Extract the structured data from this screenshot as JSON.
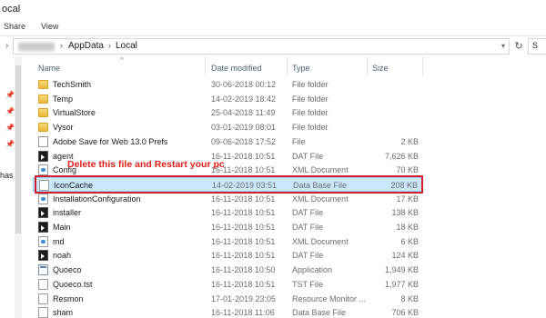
{
  "window": {
    "title_fragment": "ocal"
  },
  "ribbon": {
    "tabs": [
      "Share",
      "View"
    ]
  },
  "address": {
    "crumbs": [
      "AppData",
      "Local"
    ],
    "search_fragment": "S"
  },
  "navpane": {
    "fragments": [
      "",
      "has"
    ]
  },
  "columns": {
    "name": "Name",
    "date": "Date modified",
    "type": "Type",
    "size": "Size"
  },
  "files": [
    {
      "name": "TechSmith",
      "date": "30-06-2018 00:12",
      "type": "File folder",
      "size": "",
      "icon": "folder-icon"
    },
    {
      "name": "Temp",
      "date": "14-02-2019 18:42",
      "type": "File folder",
      "size": "",
      "icon": "folder-icon"
    },
    {
      "name": "VirtualStore",
      "date": "25-04-2018 11:49",
      "type": "File folder",
      "size": "",
      "icon": "folder-icon"
    },
    {
      "name": "Vysor",
      "date": "03-01-2019 08:01",
      "type": "File folder",
      "size": "",
      "icon": "folder-icon"
    },
    {
      "name": "Adobe Save for Web 13.0 Prefs",
      "date": "09-06-2018 17:52",
      "type": "File",
      "size": "2 KB",
      "icon": "file-icon"
    },
    {
      "name": "agent",
      "date": "16-11-2018 10:51",
      "type": "DAT File",
      "size": "7,626 KB",
      "icon": "dat-file-icon"
    },
    {
      "name": "Config",
      "date": "16-11-2018 10:51",
      "type": "XML Document",
      "size": "70 KB",
      "icon": "xml-file-icon"
    },
    {
      "name": "IconCache",
      "date": "14-02-2019 03:51",
      "type": "Data Base File",
      "size": "208 KB",
      "icon": "file-icon",
      "selected": true
    },
    {
      "name": "InstallationConfiguration",
      "date": "16-11-2018 10:51",
      "type": "XML Document",
      "size": "17 KB",
      "icon": "xml-file-icon"
    },
    {
      "name": "installer",
      "date": "16-11-2018 10:51",
      "type": "DAT File",
      "size": "138 KB",
      "icon": "dat-file-icon"
    },
    {
      "name": "Main",
      "date": "16-11-2018 10:51",
      "type": "DAT File",
      "size": "18 KB",
      "icon": "dat-file-icon"
    },
    {
      "name": "md",
      "date": "16-11-2018 10:51",
      "type": "XML Document",
      "size": "6 KB",
      "icon": "xml-file-icon"
    },
    {
      "name": "noah",
      "date": "16-11-2018 10:51",
      "type": "DAT File",
      "size": "124 KB",
      "icon": "dat-file-icon"
    },
    {
      "name": "Quoeco",
      "date": "16-11-2018 10:50",
      "type": "Application",
      "size": "1,949 KB",
      "icon": "application-icon"
    },
    {
      "name": "Quoeco.tst",
      "date": "16-11-2018 10:51",
      "type": "TST File",
      "size": "1,977 KB",
      "icon": "file-icon"
    },
    {
      "name": "Resmon",
      "date": "17-01-2019 23:05",
      "type": "Resource Monitor ...",
      "size": "8 KB",
      "icon": "file-icon"
    },
    {
      "name": "sham",
      "date": "16-11-2018 11:06",
      "type": "Data Base File",
      "size": "706 KB",
      "icon": "file-icon"
    }
  ],
  "annotation": {
    "text": "Delete this file and Restart your pc",
    "color": "#e0201c"
  },
  "colors": {
    "selected_bg": "#cce8ff",
    "selected_border": "#99d1ff",
    "annotation_box": "#d31f2c"
  }
}
